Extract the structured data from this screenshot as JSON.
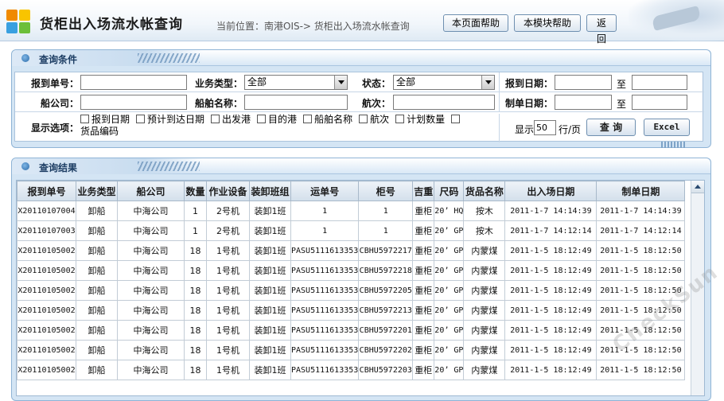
{
  "header": {
    "title": "货柜出入场流水帐查询",
    "breadcrumb": "当前位置：南港OIS-> 货柜出入场流水帐查询",
    "buttons": {
      "page_help": "本页面帮助",
      "module_help": "本模块帮助",
      "back": "返回"
    }
  },
  "query_panel": {
    "title": "查询条件",
    "row1": {
      "report_no_label": "报到单号：",
      "report_no_value": "",
      "biz_type_label": "业务类型：",
      "biz_type_value": "全部",
      "status_label": "状态：",
      "status_value": "全部",
      "report_date_label": "报到日期：",
      "report_date_from": "",
      "to_label": "至",
      "report_date_to": ""
    },
    "row2": {
      "shipping_co_label": "船公司：",
      "shipping_co_value": "",
      "vessel_label": "船舶名称：",
      "vessel_value": "",
      "voyage_label": "航次：",
      "voyage_value": "",
      "doc_date_label": "制单日期：",
      "doc_date_from": "",
      "to_label": "至",
      "doc_date_to": ""
    },
    "row3": {
      "display_label": "显示选项：",
      "options": [
        "报到日期",
        "预计到达日期",
        "出发港",
        "目的港",
        "船舶名称",
        "航次",
        "计划数量",
        "货品编码"
      ],
      "show_label": "显示",
      "page_size": "50",
      "per_page_label": "行/页",
      "query_button": "查 询",
      "excel_button": "Excel"
    }
  },
  "result_panel": {
    "title": "查询结果",
    "columns": [
      "报到单号",
      "业务类型",
      "船公司",
      "数量",
      "作业设备",
      "装卸班组",
      "运单号",
      "柜号",
      "吉重",
      "尺码",
      "货品名称",
      "出入场日期",
      "制单日期"
    ],
    "rows": [
      [
        "X20110107004",
        "卸船",
        "中海公司",
        "1",
        "2号机",
        "装卸1班",
        "1",
        "1",
        "重柜",
        "20’ HQ",
        "按木",
        "2011-1-7 14:14:39",
        "2011-1-7 14:14:39"
      ],
      [
        "X20110107003",
        "卸船",
        "中海公司",
        "1",
        "2号机",
        "装卸1班",
        "1",
        "1",
        "重柜",
        "20’ GP",
        "按木",
        "2011-1-7 14:12:14",
        "2011-1-7 14:12:14"
      ],
      [
        "X20110105002",
        "卸船",
        "中海公司",
        "18",
        "1号机",
        "装卸1班",
        "PASU5111613353",
        "CBHU5972217",
        "重柜",
        "20’ GP",
        "内蒙煤",
        "2011-1-5 18:12:49",
        "2011-1-5 18:12:50"
      ],
      [
        "X20110105002",
        "卸船",
        "中海公司",
        "18",
        "1号机",
        "装卸1班",
        "PASU5111613353",
        "CBHU5972218",
        "重柜",
        "20’ GP",
        "内蒙煤",
        "2011-1-5 18:12:49",
        "2011-1-5 18:12:50"
      ],
      [
        "X20110105002",
        "卸船",
        "中海公司",
        "18",
        "1号机",
        "装卸1班",
        "PASU5111613353",
        "CBHU5972205",
        "重柜",
        "20’ GP",
        "内蒙煤",
        "2011-1-5 18:12:49",
        "2011-1-5 18:12:50"
      ],
      [
        "X20110105002",
        "卸船",
        "中海公司",
        "18",
        "1号机",
        "装卸1班",
        "PASU5111613353",
        "CBHU5972213",
        "重柜",
        "20’ GP",
        "内蒙煤",
        "2011-1-5 18:12:49",
        "2011-1-5 18:12:50"
      ],
      [
        "X20110105002",
        "卸船",
        "中海公司",
        "18",
        "1号机",
        "装卸1班",
        "PASU5111613353",
        "CBHU5972201",
        "重柜",
        "20’ GP",
        "内蒙煤",
        "2011-1-5 18:12:49",
        "2011-1-5 18:12:50"
      ],
      [
        "X20110105002",
        "卸船",
        "中海公司",
        "18",
        "1号机",
        "装卸1班",
        "PASU5111613353",
        "CBHU5972202",
        "重柜",
        "20’ GP",
        "内蒙煤",
        "2011-1-5 18:12:49",
        "2011-1-5 18:12:50"
      ],
      [
        "X20110105002",
        "卸船",
        "中海公司",
        "18",
        "1号机",
        "装卸1班",
        "PASU5111613353",
        "CBHU5972203",
        "重柜",
        "20’ GP",
        "内蒙煤",
        "2011-1-5 18:12:49",
        "2011-1-5 18:12:50"
      ]
    ]
  },
  "watermark": "CheckSun"
}
